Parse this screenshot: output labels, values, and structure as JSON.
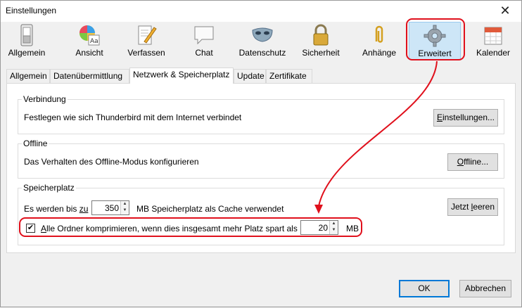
{
  "window": {
    "title": "Einstellungen",
    "close_glyph": "✕"
  },
  "toolbar": [
    {
      "label": "Allgemein",
      "icon": "switch-icon"
    },
    {
      "label": "Ansicht",
      "icon": "palette-icon"
    },
    {
      "label": "Verfassen",
      "icon": "pen-paper-icon"
    },
    {
      "label": "Chat",
      "icon": "speech-bubble-icon"
    },
    {
      "label": "Datenschutz",
      "icon": "mask-icon"
    },
    {
      "label": "Sicherheit",
      "icon": "padlock-icon"
    },
    {
      "label": "Anhänge",
      "icon": "paperclip-icon"
    },
    {
      "label": "Erweitert",
      "icon": "gear-icon",
      "selected": true
    },
    {
      "label": "Kalender",
      "icon": "calendar-icon"
    }
  ],
  "tabs": [
    {
      "label": "Allgemein"
    },
    {
      "label": "Datenübermittlung"
    },
    {
      "label": "Netzwerk & Speicherplatz",
      "active": true
    },
    {
      "label": "Update"
    },
    {
      "label": "Zertifikate"
    }
  ],
  "verbindung": {
    "title": "Verbindung",
    "text": "Festlegen wie sich Thunderbird mit dem Internet verbindet",
    "button_underlined": "E",
    "button_rest": "instellungen..."
  },
  "offline": {
    "title": "Offline",
    "text": "Das Verhalten des Offline-Modus konfigurieren",
    "button_underlined": "O",
    "button_rest": "ffline..."
  },
  "speicherplatz": {
    "title": "Speicherplatz",
    "cache_prefix": "Es werden bis ",
    "cache_prefix_underlined": "zu",
    "cache_value": "350",
    "cache_suffix": "MB Speicherplatz als Cache verwendet",
    "clear_button_prefix": "Jetzt ",
    "clear_button_underlined": "l",
    "clear_button_rest": "eeren",
    "compact_checked": true,
    "compact_label_underlined": "A",
    "compact_label_rest": "lle Ordner komprimieren, wenn dies insgesamt mehr Platz spart als",
    "compact_value": "20",
    "compact_unit": "MB"
  },
  "footer": {
    "ok": "OK",
    "cancel": "Abbrechen"
  },
  "colors": {
    "highlight": "#e0101c",
    "selected_bg": "#cde6f7",
    "accent": "#0078d7"
  }
}
